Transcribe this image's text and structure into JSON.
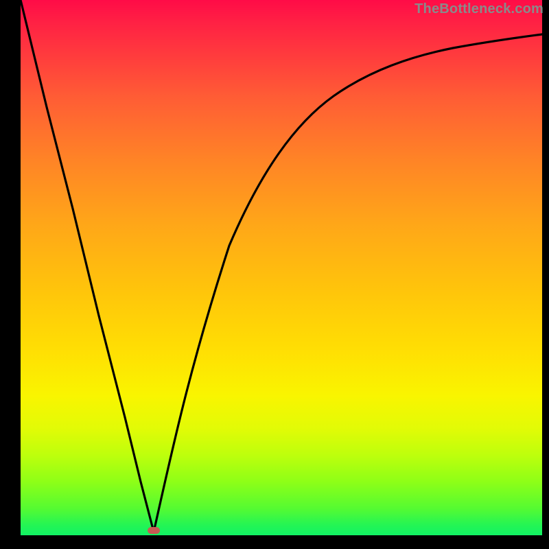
{
  "watermark": "TheBottleneck.com",
  "marker": {
    "x_pct": 25.5,
    "y_pct": 99.0
  },
  "chart_data": {
    "type": "line",
    "title": "",
    "xlabel": "",
    "ylabel": "",
    "xlim": [
      0,
      100
    ],
    "ylim": [
      0,
      100
    ],
    "series": [
      {
        "name": "bottleneck-curve",
        "x": [
          0,
          5,
          10,
          15,
          20,
          23,
          25.5,
          28,
          31,
          35,
          40,
          45,
          50,
          55,
          60,
          65,
          70,
          75,
          80,
          85,
          90,
          95,
          100
        ],
        "values": [
          100,
          80,
          61,
          41,
          22,
          10,
          0.6,
          10,
          24,
          40,
          54,
          64,
          71,
          76,
          80,
          83,
          85.5,
          87.2,
          88.5,
          89.6,
          90.4,
          91,
          91.5
        ]
      }
    ],
    "annotations": [
      {
        "type": "marker",
        "x": 25.5,
        "y": 0.6,
        "label": "optimal-point"
      }
    ],
    "background_gradient": {
      "direction": "vertical",
      "stops": [
        {
          "pos": 0,
          "color": "#ff0b47"
        },
        {
          "pos": 50,
          "color": "#ffbc0f"
        },
        {
          "pos": 75,
          "color": "#f5f900"
        },
        {
          "pos": 100,
          "color": "#11f264"
        }
      ]
    }
  }
}
